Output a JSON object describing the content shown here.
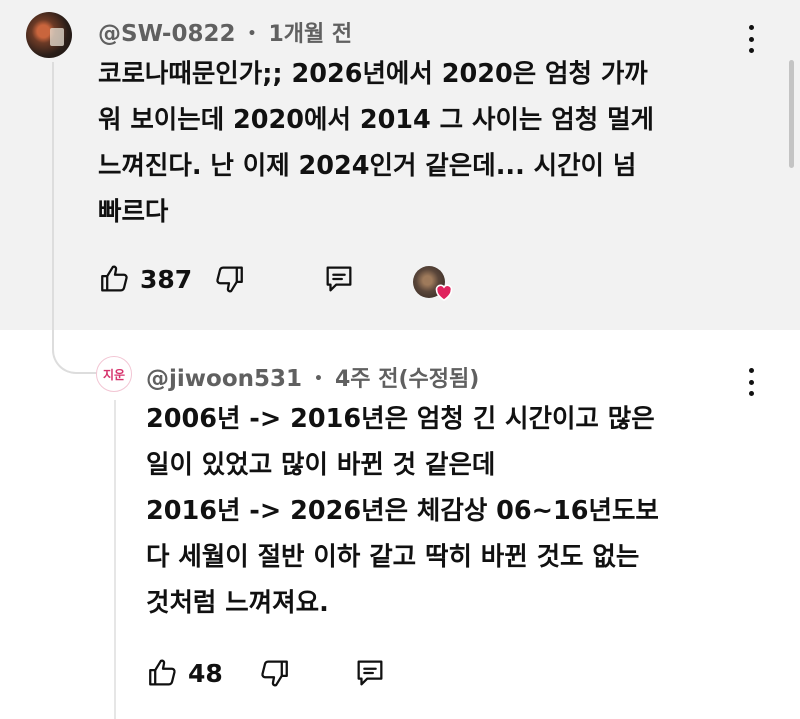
{
  "comment": {
    "author": "@SW-0822",
    "separator": "•",
    "time": "1개월 전",
    "lines": [
      "코로나때문인가;; 2026년에서 2020은 엄청 가까",
      "워 보이는데 2020에서 2014 그 사이는 엄청 멀게",
      "느껴진다. 난 이제 2024인거 같은데... 시간이 넘",
      "빠르다"
    ],
    "likes": "387"
  },
  "reply": {
    "avatar_text": "지운",
    "author": "@jiwoon531",
    "separator": "•",
    "time": "4주 전",
    "edited": "(수정됨)",
    "lines": [
      "2006년 -> 2016년은 엄청 긴 시간이고 많은",
      "일이 있었고 많이 바뀐 것 같은데",
      "2016년 -> 2026년은 체감상 06~16년도보",
      "다 세월이 절반 이하 같고 딱히 바뀐 것도 없는",
      "것처럼 느껴져요."
    ],
    "likes": "48"
  },
  "colors": {
    "comment_bg": "#f2f2f2",
    "meta_text": "#606060",
    "heart": "#e0245e",
    "reply_avatar_text": "#d6336c"
  },
  "icons": [
    "more-vert-icon",
    "thumb-up-icon",
    "thumb-down-icon",
    "reply-icon",
    "heart-icon"
  ]
}
